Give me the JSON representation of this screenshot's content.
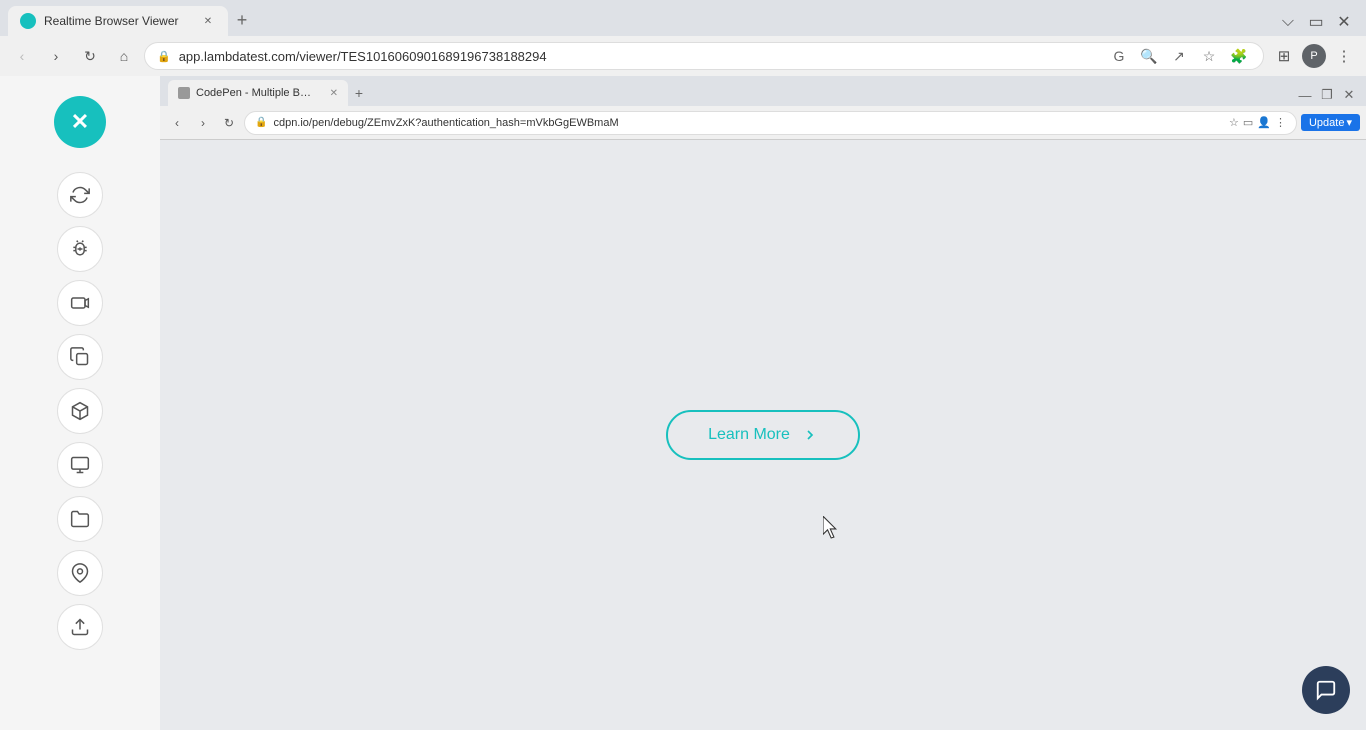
{
  "outer_browser": {
    "tab_title": "Realtime Browser Viewer",
    "tab_favicon_color": "#17c0be",
    "address_url": "app.lambdatest.com/viewer/TES101606090168919673818829​4",
    "nav": {
      "back": "‹",
      "forward": "›",
      "reload": "↻",
      "home": "⌂"
    },
    "tab_controls": {
      "minimize": "—",
      "maximize": "❐",
      "close": "✕"
    }
  },
  "inner_browser": {
    "tab_title": "CodePen - Multiple Button Tran...",
    "address_url": "cdpn.io/pen/debug/ZEmvZxK?authentication_hash=mVkbGgEWBmaM",
    "update_btn_label": "Update",
    "controls": {
      "minimize": "—",
      "restore": "❐",
      "close": "✕"
    }
  },
  "sidebar": {
    "close_icon": "✕",
    "icons": [
      {
        "name": "sync-icon",
        "symbol": "⟳"
      },
      {
        "name": "bug-icon",
        "symbol": "🐛"
      },
      {
        "name": "video-icon",
        "symbol": "⬛"
      },
      {
        "name": "copy-icon",
        "symbol": "❐"
      },
      {
        "name": "cube-icon",
        "symbol": "◈"
      },
      {
        "name": "monitor-icon",
        "symbol": "▭"
      },
      {
        "name": "folder-icon",
        "symbol": "⬓"
      },
      {
        "name": "location-icon",
        "symbol": "⊙"
      },
      {
        "name": "share-icon",
        "symbol": "⬆"
      }
    ]
  },
  "learn_more_button": {
    "label": "Learn More",
    "chevron": "›",
    "color": "#17c0be"
  },
  "chat_widget": {
    "icon": "💬"
  }
}
